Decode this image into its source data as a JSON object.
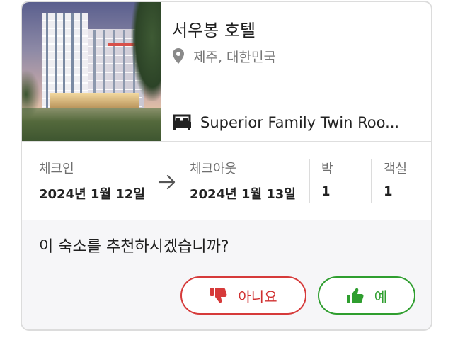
{
  "hotel": {
    "name": "서우봉 호텔",
    "location": "제주, 대한민국",
    "room": "Superior Family Twin Roo...",
    "icons": {
      "location": "map-pin-icon",
      "room": "bed-icon"
    }
  },
  "stay": {
    "checkin_label": "체크인",
    "checkin_value": "2024년 1월 12일",
    "checkout_label": "체크아웃",
    "checkout_value": "2024년 1월 13일",
    "nights_label": "박",
    "nights_value": "1",
    "rooms_label": "객실",
    "rooms_value": "1"
  },
  "recommend": {
    "question": "이 숙소를 추천하시겠습니까?",
    "no_label": "아니요",
    "yes_label": "예"
  },
  "colors": {
    "no": "#d63a3a",
    "yes": "#2f9e2f",
    "section_bg": "#f6f6f8"
  }
}
